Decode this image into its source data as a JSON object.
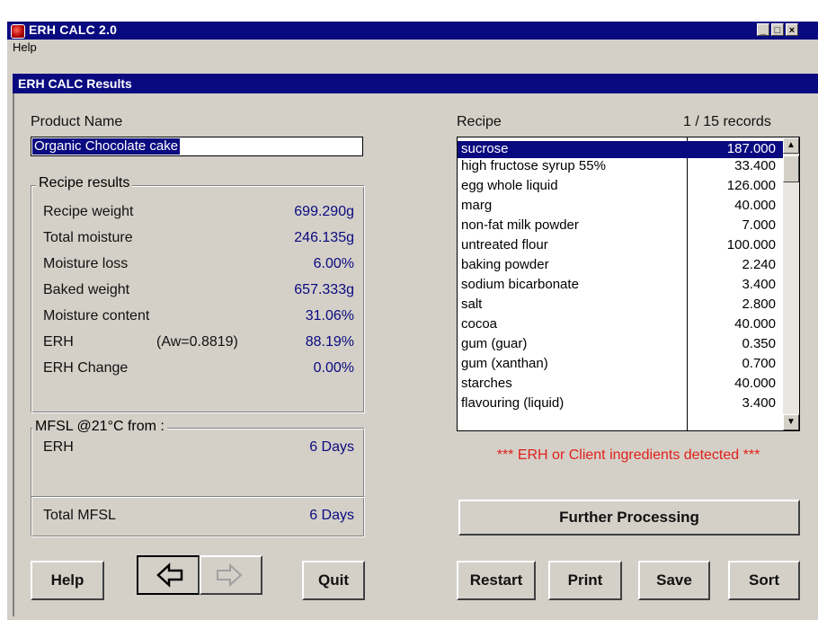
{
  "window": {
    "title": "ERH CALC 2.0"
  },
  "menu": {
    "help": "Help"
  },
  "panel": {
    "title": "ERH CALC Results"
  },
  "product": {
    "label": "Product Name",
    "value": "Organic Chocolate cake"
  },
  "recipe_results": {
    "title": "Recipe results",
    "rows": [
      {
        "label": "Recipe weight",
        "value": "699.290g"
      },
      {
        "label": "Total moisture",
        "value": "246.135g"
      },
      {
        "label": "Moisture loss",
        "value": "6.00%"
      },
      {
        "label": "Baked weight",
        "value": "657.333g"
      },
      {
        "label": "Moisture content",
        "value": "31.06%"
      },
      {
        "label": "ERH",
        "extra": "(Aw=0.8819)",
        "value": "88.19%"
      },
      {
        "label": "ERH Change",
        "value": "0.00%"
      }
    ]
  },
  "mfsl": {
    "title": "MFSL  @21°C from :",
    "erh_label": "ERH",
    "erh_value": "6 Days",
    "total_label": "Total MFSL",
    "total_value": "6 Days"
  },
  "recipe": {
    "label": "Recipe",
    "records": "1 / 15  records",
    "items": [
      {
        "name": "sucrose",
        "qty": "187.000"
      },
      {
        "name": "high fructose syrup 55%",
        "qty": "33.400"
      },
      {
        "name": "egg whole liquid",
        "qty": "126.000"
      },
      {
        "name": "marg",
        "qty": "40.000"
      },
      {
        "name": "non-fat milk powder",
        "qty": "7.000"
      },
      {
        "name": "untreated flour",
        "qty": "100.000"
      },
      {
        "name": "baking powder",
        "qty": "2.240"
      },
      {
        "name": "sodium bicarbonate",
        "qty": "3.400"
      },
      {
        "name": "salt",
        "qty": "2.800"
      },
      {
        "name": "cocoa",
        "qty": "40.000"
      },
      {
        "name": "gum (guar)",
        "qty": "0.350"
      },
      {
        "name": "gum (xanthan)",
        "qty": "0.700"
      },
      {
        "name": "starches",
        "qty": "40.000"
      },
      {
        "name": "flavouring (liquid)",
        "qty": "3.400"
      }
    ]
  },
  "warning": "*** ERH or Client ingredients detected ***",
  "buttons": {
    "further_processing": "Further Processing",
    "help": "Help",
    "quit": "Quit",
    "restart": "Restart",
    "print": "Print",
    "save": "Save",
    "sort": "Sort"
  },
  "colors": {
    "title_bar": "#0a0a80",
    "value_text": "#0a0a80",
    "warning_text": "#e0201a",
    "face": "#d4d0c8"
  },
  "icons": {
    "app": "app-icon",
    "back": "arrow-left-icon",
    "forward": "arrow-right-icon"
  }
}
